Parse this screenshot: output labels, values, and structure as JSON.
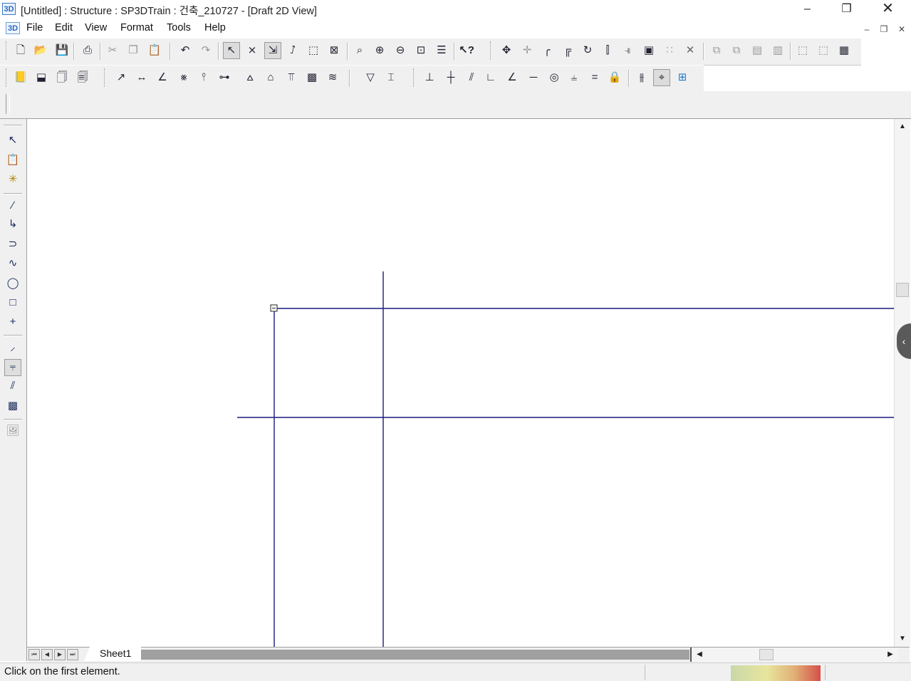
{
  "window": {
    "app_icon": "3D",
    "title": "[Untitled] : Structure : SP3DTrain : 건축_210727 - [Draft 2D View]",
    "minimize_icon": "minimize-icon",
    "restore_icon": "restore-icon",
    "close_icon": "close-icon"
  },
  "menubar": {
    "doc_icon": "3D",
    "items": [
      "File",
      "Edit",
      "View",
      "Format",
      "Tools",
      "Help"
    ]
  },
  "toolbar1": {
    "buttons": [
      "new-icon",
      "open-icon",
      "save-icon",
      "print-icon",
      "cut-icon",
      "copy-icon",
      "paste-icon",
      "undo-icon",
      "redo-icon",
      "select-tool-icon",
      "trim-icon",
      "extend-icon",
      "split-icon",
      "layer-icon",
      "fit-icon",
      "zoom-area-icon",
      "zoom-in-icon",
      "zoom-out-icon",
      "zoom-extents-icon",
      "pan-icon",
      "help-pointer-icon",
      "move-icon",
      "copy-move-icon",
      "fillet-icon",
      "offset-icon",
      "rotate-icon",
      "mirror-icon",
      "align-icon",
      "scale-icon",
      "array-icon",
      "delete-icon",
      "bring-front-icon",
      "send-back-icon",
      "group-icon",
      "ungroup-icon",
      "frame-icon",
      "frame-2-icon",
      "frame-3-icon"
    ]
  },
  "toolbar2": {
    "buttons": [
      "smart-dim-icon",
      "dim-distance-icon",
      "dim-angle-icon",
      "dim-radial-icon",
      "dim-coordinate-icon",
      "dim-chain-icon",
      "hatch-icon",
      "text-icon",
      "balloon-icon",
      "label-icon",
      "weld-icon",
      "symbol-icon",
      "line-style-icon",
      "connect-icon",
      "horizontal-icon",
      "vertical-icon",
      "parallel-icon",
      "perpendicular-icon",
      "tangent-icon",
      "collinear-icon",
      "concentric-icon",
      "symmetric-icon",
      "equal-icon",
      "lock-icon",
      "relation-icon",
      "intersect-icon",
      "dimension-group-icon"
    ]
  },
  "lefttoolbar": {
    "buttons": [
      "select-arrow-icon",
      "paste-drawing-icon",
      "smart-select-icon",
      "line-icon",
      "polyline-icon",
      "arc-icon",
      "curve-icon",
      "circle-icon",
      "rectangle-icon",
      "point-icon",
      "fillet-tool-icon",
      "trim-tool-icon",
      "offset-tool-icon",
      "fill-icon",
      "image-icon"
    ]
  },
  "canvas": {
    "grid_color": "#1a1a80"
  },
  "sheet_tabs": {
    "nav": [
      "first-sheet-icon",
      "prev-sheet-icon",
      "next-sheet-icon",
      "last-sheet-icon"
    ],
    "active": "Sheet1"
  },
  "status": {
    "message": "Click on the first element."
  },
  "sidebar_toggle": "chevron-left-icon"
}
